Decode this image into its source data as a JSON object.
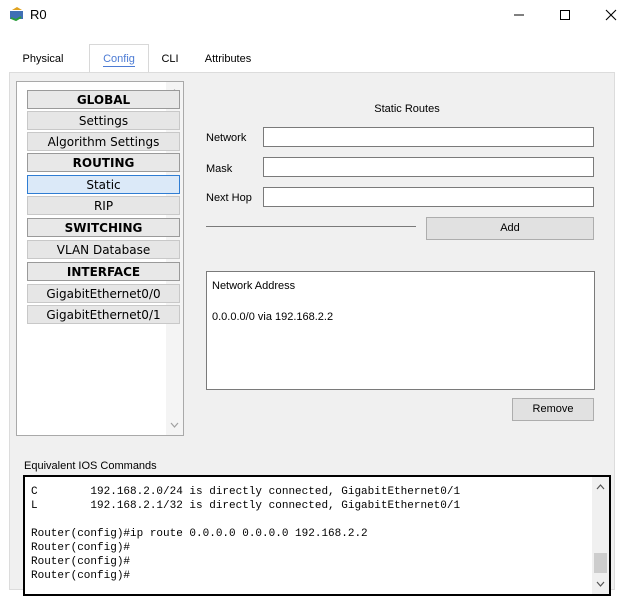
{
  "window": {
    "title": "R0",
    "icon": "router-icon"
  },
  "tabs": [
    {
      "label": "Physical",
      "active": false
    },
    {
      "label": "Config",
      "active": true
    },
    {
      "label": "CLI",
      "active": false
    },
    {
      "label": "Attributes",
      "active": false
    }
  ],
  "sidebar": {
    "global_header": "GLOBAL",
    "settings": "Settings",
    "algorithm_settings": "Algorithm Settings",
    "routing_header": "ROUTING",
    "static": "Static",
    "rip": "RIP",
    "switching_header": "SWITCHING",
    "vlan_database": "VLAN Database",
    "interface_header": "INTERFACE",
    "gig0": "GigabitEthernet0/0",
    "gig1": "GigabitEthernet0/1",
    "selected": "Static"
  },
  "static_routes": {
    "title": "Static Routes",
    "network_label": "Network",
    "network_value": "",
    "mask_label": "Mask",
    "mask_value": "",
    "next_hop_label": "Next Hop",
    "next_hop_value": "",
    "add_button": "Add",
    "list_header": "Network Address",
    "routes": [
      "0.0.0.0/0 via 192.168.2.2"
    ],
    "remove_button": "Remove"
  },
  "ios": {
    "label": "Equivalent IOS Commands",
    "lines": [
      "C        192.168.2.0/24 is directly connected, GigabitEthernet0/1",
      "L        192.168.2.1/32 is directly connected, GigabitEthernet0/1",
      "",
      "Router(config)#ip route 0.0.0.0 0.0.0.0 192.168.2.2",
      "Router(config)#",
      "Router(config)#",
      "Router(config)#"
    ]
  },
  "colors": {
    "accent": "#4c7bd4",
    "selection": "#2f7dd3"
  }
}
